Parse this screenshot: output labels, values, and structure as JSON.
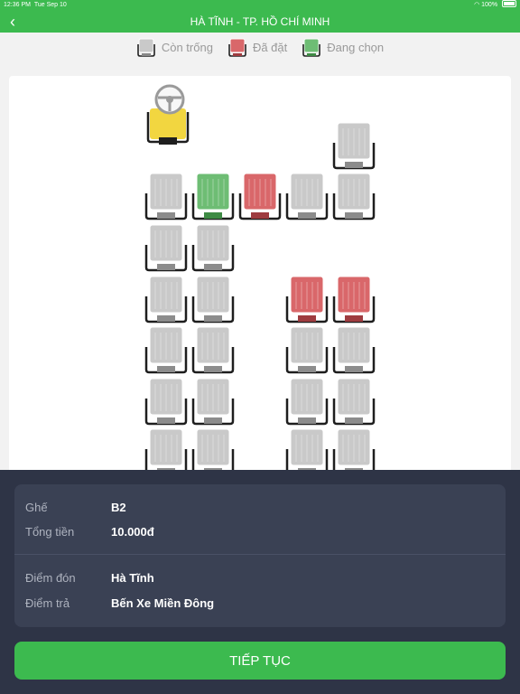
{
  "status_bar": {
    "time": "12:36 PM",
    "date": "Tue Sep 10",
    "battery": "100%"
  },
  "header": {
    "back_icon": "chevron-left-icon",
    "title": "HÀ TĨNH - TP. HỒ CHÍ MINH"
  },
  "legend": [
    {
      "label": "Còn trống",
      "status": "available"
    },
    {
      "label": "Đã đặt",
      "status": "booked"
    },
    {
      "label": "Đang chọn",
      "status": "selected"
    }
  ],
  "colors": {
    "brand": "#3cba4f",
    "available": "#c9c9c9",
    "booked": "#d9676a",
    "selected": "#6ebd74",
    "driver": "#f2d640",
    "panel": "#2e3446"
  },
  "seat_map": {
    "driver_icon": "steering-wheel-icon",
    "rows": [
      {
        "row": 1,
        "seats": [
          null,
          null,
          null,
          null,
          "available"
        ]
      },
      {
        "row": 2,
        "seats": [
          "available",
          "selected",
          "booked",
          "available",
          "available"
        ]
      },
      {
        "row": 3,
        "seats": [
          "available",
          "available",
          null,
          null,
          null
        ]
      },
      {
        "row": 4,
        "seats": [
          "available",
          "available",
          null,
          "booked",
          "booked"
        ]
      },
      {
        "row": 5,
        "seats": [
          "available",
          "available",
          null,
          "available",
          "available"
        ]
      },
      {
        "row": 6,
        "seats": [
          "available",
          "available",
          null,
          "available",
          "available"
        ]
      },
      {
        "row": 7,
        "seats": [
          "available",
          "available",
          null,
          "available",
          "available"
        ]
      }
    ]
  },
  "summary": {
    "seat_label": "Ghế",
    "seat_value": "B2",
    "total_label": "Tổng tiền",
    "total_value": "10.000đ",
    "pickup_label": "Điểm đón",
    "pickup_value": "Hà Tĩnh",
    "dropoff_label": "Điểm trả",
    "dropoff_value": "Bến Xe Miền Đông"
  },
  "continue_button": "TIẾP TỤC"
}
